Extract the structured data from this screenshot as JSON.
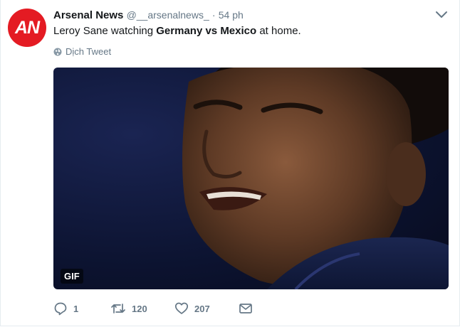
{
  "tweet": {
    "avatar_text": "AN",
    "name": "Arsenal News",
    "handle": "@__arsenalnews_",
    "separator": "·",
    "time": "54 ph",
    "text_prefix": "Leroy Sane watching ",
    "text_bold": "Germany vs Mexico",
    "text_suffix": " at home.",
    "translate_label": "Dịch Tweet",
    "media_badge": "GIF",
    "replies": "1",
    "retweets": "120",
    "likes": "207"
  },
  "icons": {
    "caret": "chevron-down-icon",
    "translate": "globe-icon",
    "reply": "reply-icon",
    "retweet": "retweet-icon",
    "like": "heart-icon",
    "message": "envelope-icon"
  },
  "colors": {
    "brand": "#e41b23",
    "muted_text": "#657786",
    "text": "#14171a"
  }
}
